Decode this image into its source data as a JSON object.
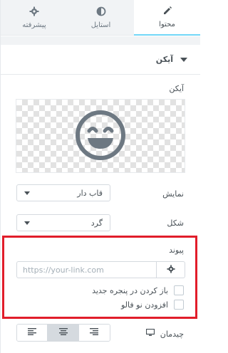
{
  "tabs": [
    {
      "label": "محتوا",
      "icon": "pencil-icon",
      "active": true
    },
    {
      "label": "استایل",
      "icon": "half-circle-icon",
      "active": false
    },
    {
      "label": "پیشرفته",
      "icon": "gear-icon",
      "active": false
    }
  ],
  "section": {
    "title": "آیکن"
  },
  "icon_control": {
    "label": "آیکن",
    "preview_icon": "smiling-face-icon"
  },
  "view_control": {
    "label": "نمایش",
    "value": "قاب دار"
  },
  "shape_control": {
    "label": "شکل",
    "value": "گرد"
  },
  "link_control": {
    "label": "پیوند",
    "placeholder": "https://your-link.com",
    "value": "",
    "open_new_window_label": "باز کردن در پنجره جدید",
    "nofollow_label": "افزودن نو فالو"
  },
  "alignment_control": {
    "label": "چیدمان",
    "device_icon": "desktop-icon",
    "options": [
      "align-left-icon",
      "align-center-icon",
      "align-right-icon"
    ],
    "selected": "align-center-icon"
  },
  "colors": {
    "highlight": "#e11d2a",
    "accent": "#71d7f7",
    "icon": "#6d7882"
  }
}
